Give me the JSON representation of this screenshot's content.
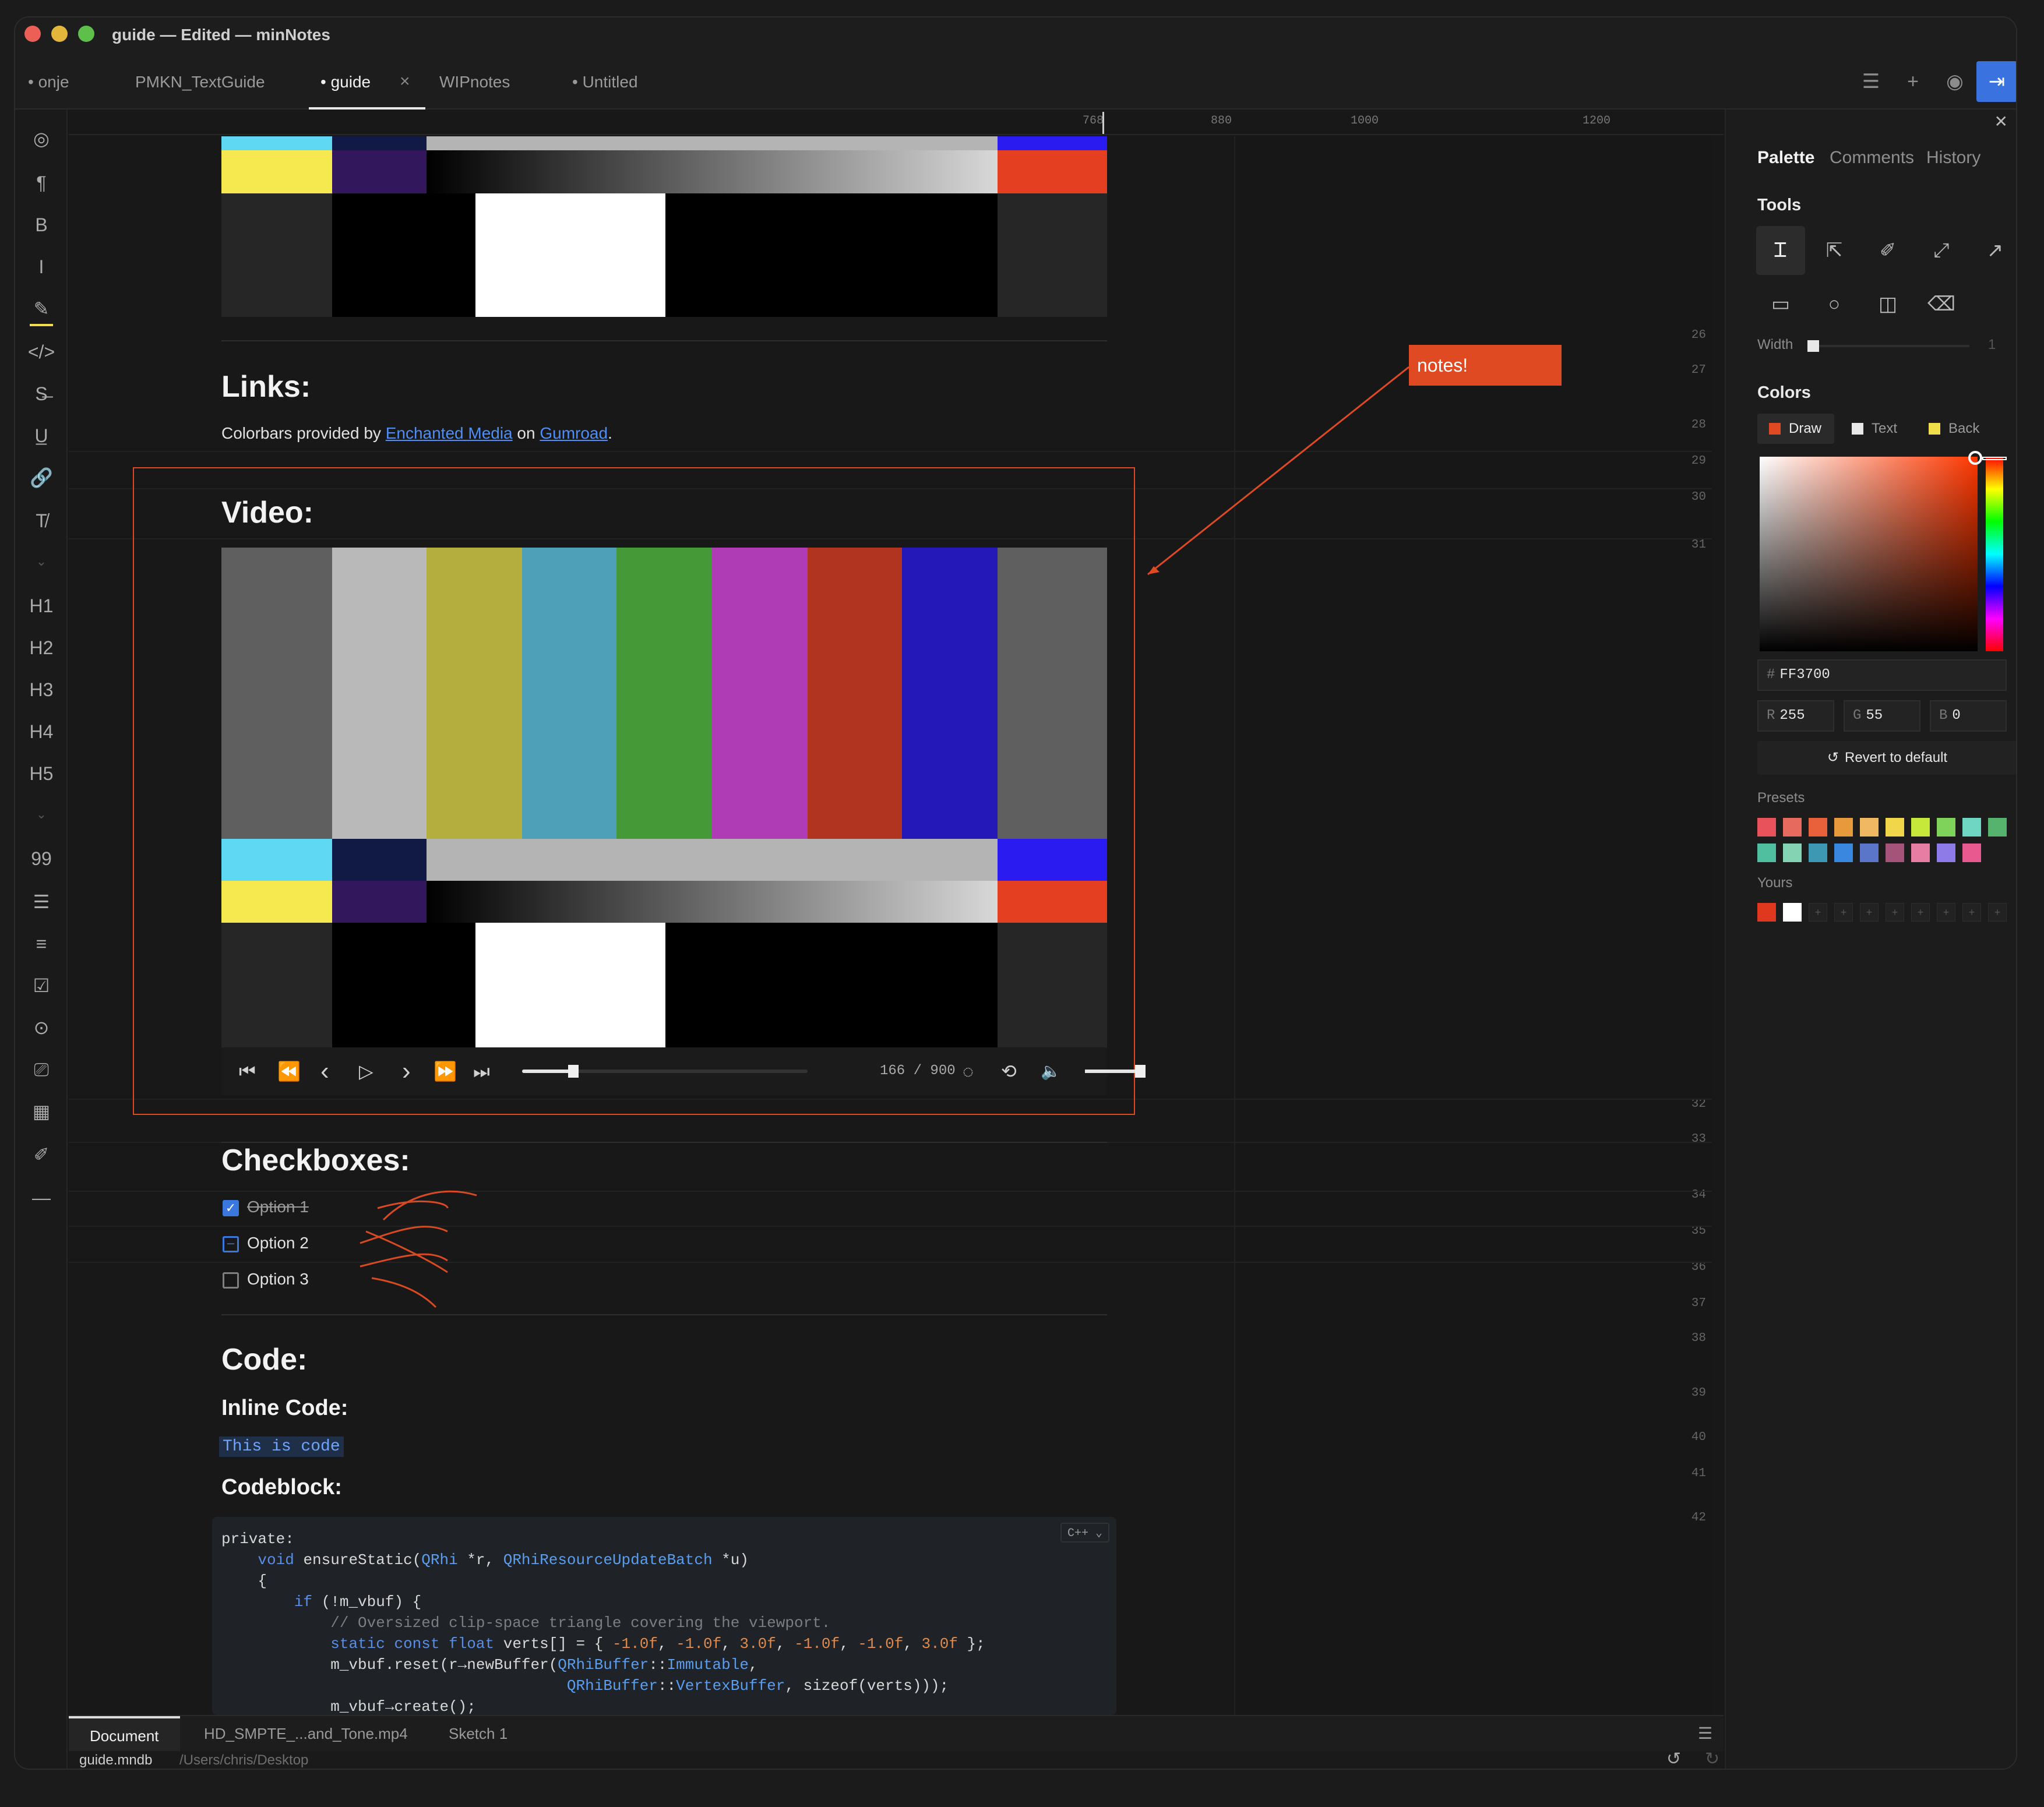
{
  "window": {
    "title": "guide — Edited — minNotes"
  },
  "tabs": [
    {
      "label": "• onje"
    },
    {
      "label": "PMKN_TextGuide"
    },
    {
      "label": "• guide"
    },
    {
      "label": "WIPnotes"
    },
    {
      "label": "• Untitled"
    }
  ],
  "tab_close": "×",
  "toolbar": {
    "list_icon": "☰",
    "add_icon": "+",
    "eye_icon": "◉",
    "panel_icon": "⇥",
    "close_icon": "✕"
  },
  "sidebar": {
    "items": [
      {
        "icon": "◎"
      },
      {
        "icon": "¶"
      },
      {
        "icon": "B"
      },
      {
        "icon": "I"
      },
      {
        "icon": "✎"
      },
      {
        "icon": "</>"
      },
      {
        "icon": "S̶"
      },
      {
        "icon": "U̲"
      },
      {
        "icon": "🔗"
      },
      {
        "icon": "T̸"
      },
      {
        "icon": "⌄"
      },
      {
        "icon": "H1"
      },
      {
        "icon": "H2"
      },
      {
        "icon": "H3"
      },
      {
        "icon": "H4"
      },
      {
        "icon": "H5"
      },
      {
        "icon": "⌄"
      },
      {
        "icon": "99"
      },
      {
        "icon": "☰"
      },
      {
        "icon": "≡"
      },
      {
        "icon": "☑"
      },
      {
        "icon": "⊙"
      },
      {
        "icon": "⎚"
      },
      {
        "icon": "▦"
      },
      {
        "icon": "✐"
      },
      {
        "icon": "—"
      }
    ]
  },
  "ruler": {
    "labels": [
      "768",
      "880",
      "1000",
      "1200"
    ]
  },
  "line_numbers": [
    "26",
    "27",
    "28",
    "29",
    "30",
    "31",
    "32",
    "33",
    "34",
    "35",
    "36",
    "37",
    "38",
    "39",
    "40",
    "41",
    "42"
  ],
  "document": {
    "links_heading": "Links:",
    "links_text_1": "Colorbars provided by ",
    "links_link_1": "Enchanted Media",
    "links_text_2": " on ",
    "links_link_2": "Gumroad",
    "links_text_3": ".",
    "video_heading": "Video:",
    "video_controls": {
      "frame": "166 / 900",
      "first": "⏮",
      "rewind": "⏪",
      "prev": "‹",
      "play": "▷",
      "next": "›",
      "ffwd": "⏩",
      "last": "⏭",
      "hide": "◌",
      "loop": "⟲",
      "volume": "🔈",
      "progress": 0.18,
      "volume_level": 0.95
    },
    "checkboxes_heading": "Checkboxes:",
    "checkboxes": [
      {
        "label": "Option 1",
        "state": "checked"
      },
      {
        "label": "Option 2",
        "state": "indeterminate"
      },
      {
        "label": "Option 3",
        "state": "unchecked"
      }
    ],
    "code_heading": "Code:",
    "inline_code_heading": "Inline Code:",
    "inline_code": "This is code",
    "codeblock_heading": "Codeblock:",
    "code_lang": "C++ ⌄",
    "code_lines": [
      "private:",
      "    void ensureStatic(QRhi *r, QRhiResourceUpdateBatch *u)",
      "    {",
      "        if (!m_vbuf) {",
      "            // Oversized clip-space triangle covering the viewport.",
      "            static const float verts[] = { -1.0f, -1.0f, 3.0f, -1.0f, -1.0f, 3.0f };",
      "            m_vbuf.reset(r→newBuffer(QRhiBuffer::Immutable,",
      "                                      QRhiBuffer::VertexBuffer, sizeof(verts)));",
      "            m_vbuf→create();"
    ]
  },
  "annotation": {
    "note": "notes!",
    "accent": "#e04a22"
  },
  "bottom_tabs": [
    {
      "label": "Document"
    },
    {
      "label": "HD_SMPTE_...and_Tone.mp4"
    },
    {
      "label": "Sketch 1"
    }
  ],
  "status": {
    "file": "guide.mndb",
    "path": "/Users/chris/Desktop",
    "undo": "↺",
    "redo": "↻"
  },
  "panel": {
    "tabs": [
      {
        "label": "Palette"
      },
      {
        "label": "Comments"
      },
      {
        "label": "History"
      }
    ],
    "tools_heading": "Tools",
    "tools": [
      "Ꮖ",
      "⇱",
      "✐",
      "⤢",
      "↗",
      "▭",
      "○",
      "◫",
      "⌫"
    ],
    "width_label": "Width",
    "width_value": "1",
    "colors_heading": "Colors",
    "color_tabs": [
      {
        "label": "Draw",
        "color": "#e04a22"
      },
      {
        "label": "Text",
        "color": "#e8e8e8"
      },
      {
        "label": "Back",
        "color": "#f2dd4a"
      }
    ],
    "hex_prefix": "#",
    "hex": "FF3700",
    "r_label": "R",
    "r": "255",
    "g_label": "G",
    "g": "55",
    "b_label": "B",
    "b": "0",
    "revert": "Revert to default",
    "presets_label": "Presets",
    "presets": [
      "#e8525a",
      "#e76a5f",
      "#e8613a",
      "#e89a3a",
      "#f0b860",
      "#f2d64a",
      "#c6e83a",
      "#7fd35a",
      "#6fd6c3",
      "#55b36e",
      "#4fbfa0",
      "#84d3b2",
      "#3d98b3",
      "#3a87e0",
      "#5a76c8",
      "#a35478",
      "#e87da3",
      "#8e7be8",
      "#e85a8f"
    ],
    "yours_label": "Yours",
    "yours": [
      "#e0381e",
      "#ffffff"
    ],
    "yours_empty": "+"
  }
}
